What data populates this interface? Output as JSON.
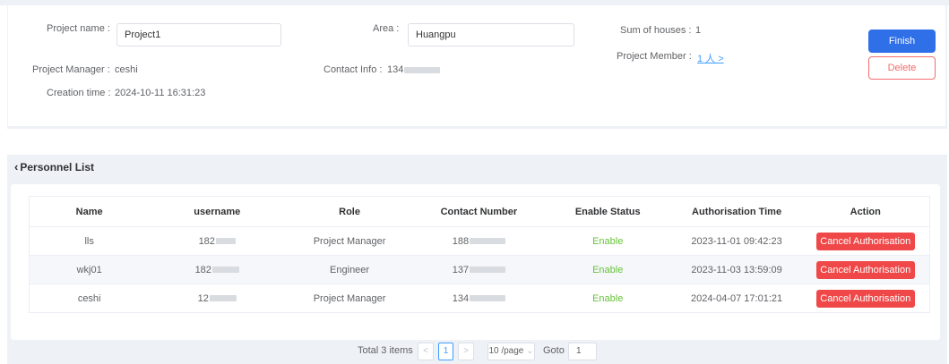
{
  "project": {
    "name_label": "Project name :",
    "name_value": "Project1",
    "area_label": "Area :",
    "area_value": "Huangpu",
    "houses_label": "Sum of houses :",
    "houses_value": "1",
    "manager_label": "Project Manager :",
    "manager_value": "ceshi",
    "contact_label": "Contact Info :",
    "contact_value": "134",
    "member_label": "Project Member :",
    "member_value": "1 人 >",
    "creation_label": "Creation time :",
    "creation_value": "2024-10-11 16:31:23"
  },
  "actions": {
    "finish_label": "Finish",
    "delete_label": "Delete"
  },
  "personnel": {
    "title": "Personnel List",
    "columns": [
      "Name",
      "username",
      "Role",
      "Contact Number",
      "Enable Status",
      "Authorisation Time",
      "Action"
    ],
    "rows": [
      {
        "name": "lls",
        "username": "182",
        "role": "Project Manager",
        "contact": "188",
        "status": "Enable",
        "time": "2023-11-01 09:42:23",
        "action": "Cancel Authorisation"
      },
      {
        "name": "wkj01",
        "username": "182",
        "role": "Engineer",
        "contact": "137",
        "status": "Enable",
        "time": "2023-11-03 13:59:09",
        "action": "Cancel Authorisation"
      },
      {
        "name": "ceshi",
        "username": "12",
        "role": "Project Manager",
        "contact": "134",
        "status": "Enable",
        "time": "2024-04-07 17:01:21",
        "action": "Cancel Authorisation"
      }
    ]
  },
  "pagination": {
    "total_text": "Total 3 items",
    "prev": "<",
    "current_page": "1",
    "next": ">",
    "page_size": "10 /page",
    "goto_label": "Goto",
    "goto_value": "1"
  },
  "colors": {
    "primary": "#2f6fe8",
    "danger": "#f04848",
    "success": "#67c23a",
    "link": "#409eff"
  },
  "icons": {
    "back": "chevron-left-icon",
    "size_dropdown": "chevron-down-icon"
  }
}
